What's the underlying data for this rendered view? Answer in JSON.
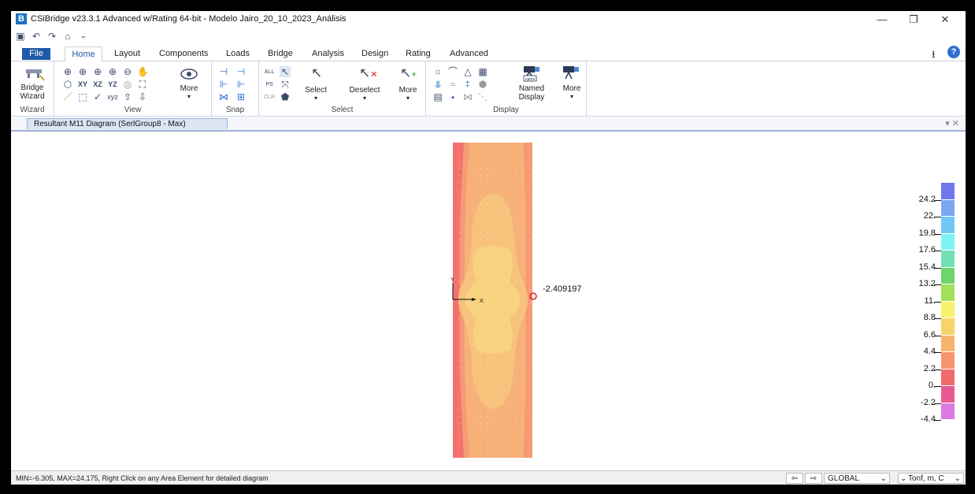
{
  "window": {
    "title": "CSiBridge v23.3.1 Advanced w/Rating 64-bit - Modelo Jairo_20_10_2023_Análisis",
    "app_icon_letter": "B",
    "minimize": "—",
    "restore": "❐",
    "close": "✕"
  },
  "tabs": {
    "file": "File",
    "home": "Home",
    "layout": "Layout",
    "components": "Components",
    "loads": "Loads",
    "bridge": "Bridge",
    "analysis": "Analysis",
    "design": "Design",
    "rating": "Rating",
    "advanced": "Advanced"
  },
  "ribbon": {
    "bridge_wizard": {
      "line1": "Bridge",
      "line2": "Wizard",
      "group": "Wizard"
    },
    "view": {
      "xy": "XY",
      "xz": "XZ",
      "yz": "YZ",
      "more": "More",
      "group": "View"
    },
    "snap": {
      "group": "Snap"
    },
    "select": {
      "all": "ALL",
      "ps": "PS",
      "clr": "CLR",
      "select": "Select",
      "deselect": "Deselect",
      "more": "More",
      "group": "Select"
    },
    "display": {
      "named_line1": "Named",
      "named_line2": "Display",
      "more": "More",
      "name_tag": "name",
      "group": "Display"
    }
  },
  "document_tab": "Resultant M11 Diagram   (SerlGroup8 - Max)",
  "diagram": {
    "value_label": "-2.409197",
    "axis_x": "X",
    "axis_y": "Y"
  },
  "legend": {
    "labels": [
      "24.2",
      "22.",
      "19.8",
      "17.6",
      "15.4",
      "13.2",
      "11.",
      "8.8",
      "6.6",
      "4.4",
      "2.2",
      "0.",
      "-2.2",
      "-4.4"
    ],
    "colors": [
      "#6f77ea",
      "#7aa7f2",
      "#72c8f5",
      "#7ef2f2",
      "#72e0b4",
      "#6ed46e",
      "#a2e05a",
      "#f7f36a",
      "#f7d46a",
      "#f7b46e",
      "#f7946e",
      "#f06a6a",
      "#e85a92",
      "#dd7ae2"
    ]
  },
  "status_bar": {
    "message": "MIN=-6.305, MAX=24.175, Right Click on any Area Element for detailed diagram",
    "coord_system": "GLOBAL",
    "units": "Tonf, m, C"
  }
}
